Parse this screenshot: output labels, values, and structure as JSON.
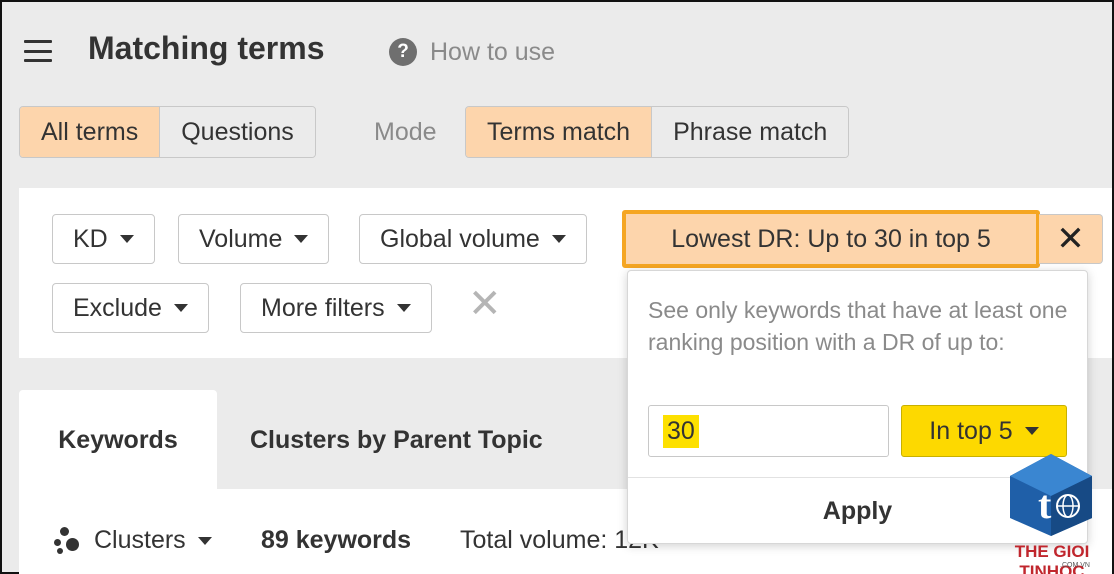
{
  "header": {
    "title": "Matching terms",
    "help_label": "How to use"
  },
  "terms_toggle": {
    "items": [
      "All terms",
      "Questions"
    ],
    "active": "All terms"
  },
  "mode": {
    "label": "Mode",
    "items": [
      "Terms match",
      "Phrase match"
    ],
    "active": "Terms match"
  },
  "filters": {
    "kd": "KD",
    "volume": "Volume",
    "global_volume": "Global volume",
    "lowest_dr": "Lowest DR: Up to 30 in top 5",
    "exclude": "Exclude",
    "more_filters": "More filters"
  },
  "popover": {
    "description": "See only keywords that have at least one ranking position with a DR of up to:",
    "dr_value": "30",
    "position_select": "In top 5",
    "apply_label": "Apply"
  },
  "tabs": {
    "keywords": "Keywords",
    "clusters": "Clusters by Parent Topic"
  },
  "results": {
    "clusters_label": "Clusters",
    "keyword_count": "89 keywords",
    "total_volume": "Total volume: 12K"
  },
  "watermark": {
    "brand": "THE GIOI TINHOC",
    "domain": ".COM.VN"
  },
  "colors": {
    "accent_active": "#fdd5ac",
    "highlight_border": "#f5a623",
    "select_yellow": "#fdd900",
    "brand_red": "#c0262d"
  }
}
